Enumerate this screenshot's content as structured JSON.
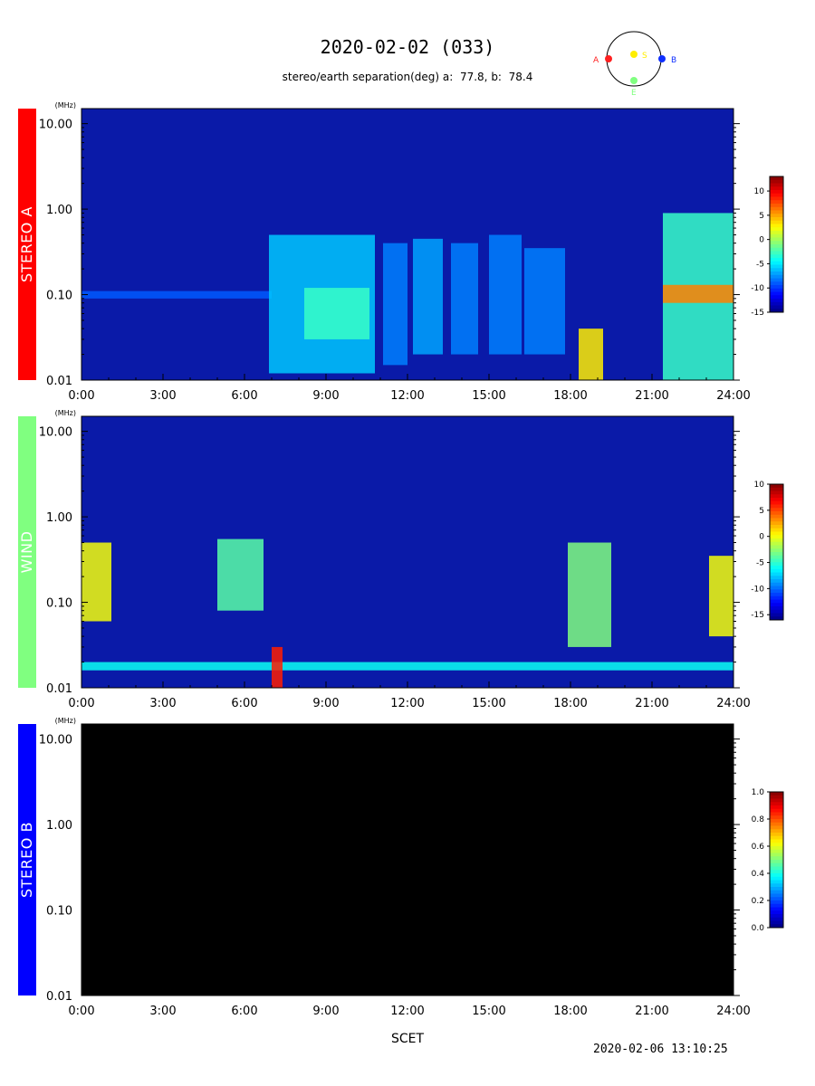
{
  "title": "2020-02-02 (033)",
  "subtitle": {
    "label": "stereo/earth separation(deg)",
    "a_label": "a:",
    "a_value": "77.8",
    "b_label": "b:",
    "b_value": "78.4"
  },
  "orbit": {
    "labels": {
      "a": "A",
      "s": "S",
      "b": "B",
      "e": "E"
    },
    "colors": {
      "a": "#ff2020",
      "s": "#ffee00",
      "b": "#1030ff",
      "e": "#80ff80"
    }
  },
  "panels": [
    {
      "name": "STEREO A",
      "color": "#ff0000"
    },
    {
      "name": "WIND",
      "color": "#80ff80"
    },
    {
      "name": "STEREO B",
      "color": "#0000ff"
    }
  ],
  "x_label": "SCET",
  "timestamp": "2020-02-06 13:10:25",
  "chart_data": [
    {
      "type": "heatmap",
      "panel": "STEREO A",
      "yunit": "(MHz)",
      "yscale": "log",
      "ylim": [
        0.01,
        15
      ],
      "yticks": [
        0.01,
        0.1,
        1.0,
        10.0
      ],
      "ytick_labels": [
        "0.01",
        "0.10",
        "1.00",
        "10.00"
      ],
      "xlim": [
        0,
        24
      ],
      "xticks": [
        0,
        3,
        6,
        9,
        12,
        15,
        18,
        21,
        24
      ],
      "xtick_labels": [
        "0:00",
        "3:00",
        "6:00",
        "9:00",
        "12:00",
        "15:00",
        "18:00",
        "21:00",
        "24:00"
      ],
      "colorbar": {
        "min": -15,
        "max": 13,
        "ticks": [
          10,
          5,
          0,
          -5,
          -10,
          -15
        ]
      },
      "background": "#0a1aa8",
      "features": [
        {
          "x": [
            0,
            7
          ],
          "y": [
            0.09,
            0.11
          ],
          "level": -9
        },
        {
          "x": [
            6.9,
            10.8
          ],
          "y": [
            0.012,
            0.5
          ],
          "level": -6
        },
        {
          "x": [
            8.2,
            10.6
          ],
          "y": [
            0.03,
            0.12
          ],
          "level": -3
        },
        {
          "x": [
            11.1,
            12.0
          ],
          "y": [
            0.015,
            0.4
          ],
          "level": -8
        },
        {
          "x": [
            12.2,
            13.3
          ],
          "y": [
            0.02,
            0.45
          ],
          "level": -7
        },
        {
          "x": [
            13.6,
            14.6
          ],
          "y": [
            0.02,
            0.4
          ],
          "level": -8
        },
        {
          "x": [
            15.0,
            16.2
          ],
          "y": [
            0.02,
            0.5
          ],
          "level": -8
        },
        {
          "x": [
            16.3,
            17.8
          ],
          "y": [
            0.02,
            0.35
          ],
          "level": -8
        },
        {
          "x": [
            18.3,
            19.2
          ],
          "y": [
            0.01,
            0.04
          ],
          "level": 3
        },
        {
          "x": [
            21.4,
            24
          ],
          "y": [
            0.01,
            0.9
          ],
          "level": -3
        },
        {
          "x": [
            21.4,
            24
          ],
          "y": [
            0.08,
            0.13
          ],
          "level": 6
        }
      ]
    },
    {
      "type": "heatmap",
      "panel": "WIND",
      "yunit": "(MHz)",
      "yscale": "log",
      "ylim": [
        0.01,
        15
      ],
      "yticks": [
        0.01,
        0.1,
        1.0,
        10.0
      ],
      "ytick_labels": [
        "0.01",
        "0.10",
        "1.00",
        "10.00"
      ],
      "xlim": [
        0,
        24
      ],
      "xticks": [
        0,
        3,
        6,
        9,
        12,
        15,
        18,
        21,
        24
      ],
      "xtick_labels": [
        "0:00",
        "3:00",
        "6:00",
        "9:00",
        "12:00",
        "15:00",
        "18:00",
        "21:00",
        "24:00"
      ],
      "colorbar": {
        "min": -16,
        "max": 10,
        "ticks": [
          10,
          5,
          0,
          -5,
          -10,
          -15
        ]
      },
      "background": "#0a1aa8",
      "features": [
        {
          "x": [
            0,
            24
          ],
          "y": [
            0.016,
            0.02
          ],
          "level": -6
        },
        {
          "x": [
            0,
            1.1
          ],
          "y": [
            0.06,
            0.5
          ],
          "level": 0
        },
        {
          "x": [
            5.0,
            6.7
          ],
          "y": [
            0.08,
            0.55
          ],
          "level": -4
        },
        {
          "x": [
            7.0,
            7.4
          ],
          "y": [
            0.01,
            0.03
          ],
          "level": 6
        },
        {
          "x": [
            17.9,
            19.5
          ],
          "y": [
            0.03,
            0.5
          ],
          "level": -3
        },
        {
          "x": [
            23.1,
            24
          ],
          "y": [
            0.04,
            0.35
          ],
          "level": 0
        }
      ]
    },
    {
      "type": "heatmap",
      "panel": "STEREO B",
      "yunit": "(MHz)",
      "yscale": "log",
      "ylim": [
        0.01,
        15
      ],
      "yticks": [
        0.01,
        0.1,
        1.0,
        10.0
      ],
      "ytick_labels": [
        "0.01",
        "0.10",
        "1.00",
        "10.00"
      ],
      "xlim": [
        0,
        24
      ],
      "xticks": [
        0,
        3,
        6,
        9,
        12,
        15,
        18,
        21,
        24
      ],
      "xtick_labels": [
        "0:00",
        "3:00",
        "6:00",
        "9:00",
        "12:00",
        "15:00",
        "18:00",
        "21:00",
        "24:00"
      ],
      "colorbar": {
        "min": 0,
        "max": 1.0,
        "ticks": [
          1.0,
          0.8,
          0.6,
          0.4,
          0.2,
          0.0
        ],
        "tick_labels": [
          "1.0",
          "0.8",
          "0.6",
          "0.4",
          "0.2",
          "0.0"
        ]
      },
      "background": "#000000",
      "features": []
    }
  ]
}
